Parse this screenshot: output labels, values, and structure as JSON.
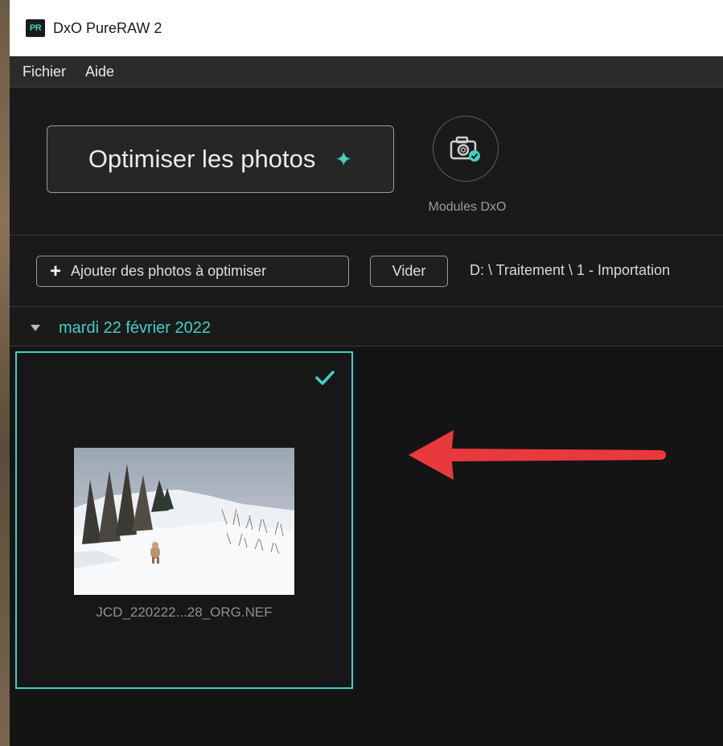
{
  "app": {
    "logo_text": "PR",
    "title": "DxO PureRAW 2"
  },
  "menu": {
    "items": [
      "Fichier",
      "Aide"
    ]
  },
  "toolbar": {
    "optimize_label": "Optimiser les photos",
    "optimize_icon": "sparkle-icon",
    "modules_label": "Modules DxO",
    "modules_icon": "camera-check-icon"
  },
  "actions": {
    "add_label": "Ajouter des photos à optimiser",
    "clear_label": "Vider",
    "path": "D: \\ Traitement \\ 1 - Importation"
  },
  "group": {
    "date_label": "mardi 22 février 2022",
    "expanded": true
  },
  "photos": [
    {
      "filename": "JCD_220222...28_ORG.NEF",
      "selected": true,
      "status_icon": "check-icon"
    }
  ],
  "colors": {
    "accent": "#3ed1c2",
    "annotation_arrow": "#e8393e",
    "background": "#141414"
  }
}
